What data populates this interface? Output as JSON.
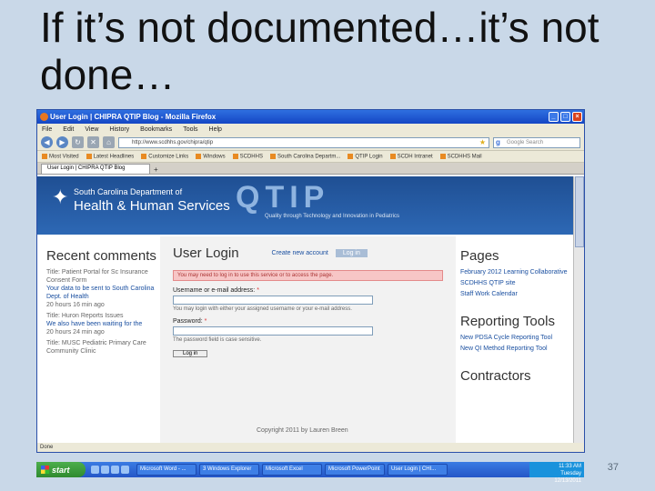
{
  "slide": {
    "title": "If it’s not documented…it’s not done…",
    "page_number": "37"
  },
  "browser": {
    "window_title": "User Login | CHIPRA QTIP Blog - Mozilla Firefox",
    "menu": [
      "File",
      "Edit",
      "View",
      "History",
      "Bookmarks",
      "Tools",
      "Help"
    ],
    "url": "http://www.scdhhs.gov/chipra/qtip",
    "search_placeholder": "Google Search",
    "bookmarks": [
      "Most Visited",
      "Latest Headlines",
      "Customize Links",
      "Windows",
      "SCDHHS",
      "South Carolina Departm...",
      "QTIP Login",
      "SCDH Intranet",
      "SCDHHS Mail"
    ],
    "tab_label": "User Login | CHIPRA QTIP Blog",
    "status": "Done"
  },
  "site": {
    "dept_line1": "South Carolina Department of",
    "dept_line2": "Health & Human Services",
    "qtip": "QTIP",
    "qtip_tagline": "Quality through Technology and Innovation in Pediatrics",
    "recent_comments_title": "Recent comments",
    "comments": [
      {
        "title": "Title: Patient Portal for Sc Insurance Consent Form",
        "body": "Your data to be sent to South Carolina Dept. of Health",
        "time": "20 hours 16 min ago"
      },
      {
        "title": "Title: Huron Reports Issues",
        "body": "We also have been waiting for the",
        "time": "20 hours 24 min ago"
      },
      {
        "title": "Title: MUSC Pediatric Primary Care Community Clinic",
        "body": "",
        "time": ""
      }
    ],
    "login_heading": "User Login",
    "create_account": "Create new account",
    "log_in_tab": "Log in",
    "alert": "You may need to log in to use this service or to access the page.",
    "username_label": "Username or e-mail address:",
    "username_hint": "You may login with either your assigned username or your e-mail address.",
    "password_label": "Password:",
    "password_hint": "The password field is case sensitive.",
    "login_button": "Log in",
    "copyright": "Copyright 2011 by Lauren Breen",
    "pages_title": "Pages",
    "pages": [
      "February 2012 Learning Collaborative",
      "SCDHHS QTIP site",
      "Staff Work Calendar"
    ],
    "reporting_title": "Reporting Tools",
    "reporting": [
      "New PDSA Cycle Reporting Tool",
      "New QI Method Reporting Tool"
    ],
    "contractors_title": "Contractors"
  },
  "taskbar": {
    "start": "start",
    "tasks": [
      "Microsoft Word - ...",
      "3 Windows Explorer",
      "Microsoft Excel",
      "Microsoft PowerPoint",
      "User Login | CHI..."
    ],
    "clock": "11:33 AM",
    "day": "Tuesday",
    "date": "12/13/2011"
  }
}
